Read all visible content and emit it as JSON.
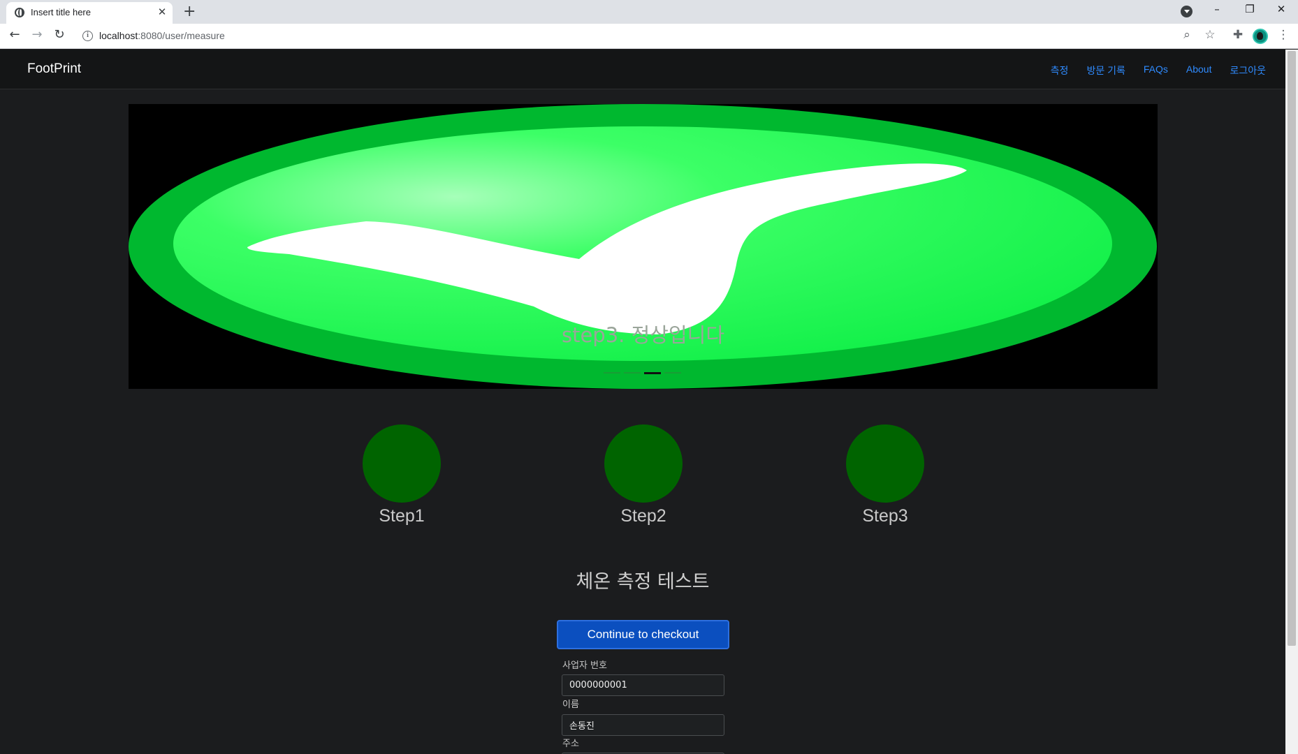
{
  "browser": {
    "tab_title": "Insert title here",
    "tab_close": "✕",
    "new_tab": "+",
    "url_host": "localhost",
    "url_path": ":8080/user/measure",
    "icons": [
      "globe-icon",
      "back-icon",
      "forward-icon",
      "reload-icon",
      "info-icon",
      "zoom-icon",
      "star-icon",
      "extensions-icon",
      "avatar",
      "menu-icon"
    ],
    "window_controls": [
      "–",
      "❐",
      "✕"
    ]
  },
  "navbar": {
    "brand": "FootPrint",
    "links": [
      "측정",
      "방문 기록",
      "FAQs",
      "About",
      "로그아웃"
    ],
    "link_color": "#2f8bff"
  },
  "carousel": {
    "caption": "step3. 정상입니다",
    "slide_count": 4,
    "active_index": 2,
    "image": "green-check-mark"
  },
  "steps": [
    {
      "label": "Step1",
      "color": "#006400"
    },
    {
      "label": "Step2",
      "color": "#006400"
    },
    {
      "label": "Step3",
      "color": "#006400"
    }
  ],
  "test": {
    "title": "체온 측정 테스트",
    "button_label": "Continue to checkout",
    "button_color": "#0b4fbf"
  },
  "form": {
    "fields": [
      {
        "label": "사업자 번호",
        "value": "0000000001"
      },
      {
        "label": "이름",
        "value": "손동진"
      },
      {
        "label": "주소",
        "value": ""
      }
    ]
  }
}
